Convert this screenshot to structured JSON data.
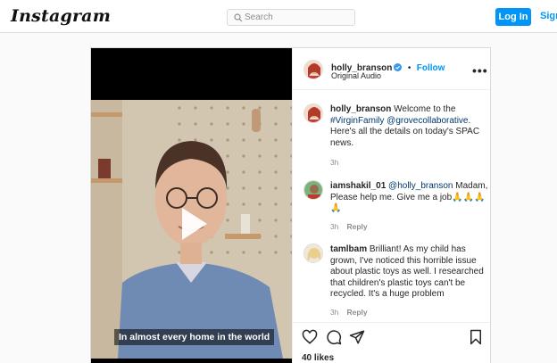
{
  "app": {
    "logo": "Instagram"
  },
  "nav": {
    "search_placeholder": "Search",
    "login_label": "Log In",
    "signup_label": "Sign"
  },
  "video": {
    "caption": "In almost every home in the world"
  },
  "post": {
    "author": "holly_branson",
    "follow_label": "Follow",
    "separator": "•",
    "audio": "Original Audio",
    "more_icon": "more-horizontal-icon"
  },
  "comments": [
    {
      "user": "holly_branson",
      "segments": [
        {
          "text": " Welcome to the "
        },
        {
          "text": "#VirginFamily",
          "link": true
        },
        {
          "text": " "
        },
        {
          "text": "@grovecollaborative",
          "link": true
        },
        {
          "text": ". Here's all the details on today's SPAC news."
        }
      ],
      "time": "3h",
      "reply": ""
    },
    {
      "user": "iamshakil_01",
      "segments": [
        {
          "text": " "
        },
        {
          "text": "@holly_branson",
          "link": true
        },
        {
          "text": " Madam, Please help me. Give me a job🙏🙏🙏🙏"
        }
      ],
      "time": "3h",
      "reply": "Reply"
    },
    {
      "user": "tamlbam",
      "segments": [
        {
          "text": " Brilliant! As my child has grown, I've noticed this horrible issue about plastic toys as well. I researched that children's plastic toys can't be recycled. It's a huge problem"
        }
      ],
      "time": "3h",
      "reply": "Reply"
    }
  ],
  "likes": "40 likes",
  "colors": {
    "accent": "#0095f6",
    "link": "#00376b",
    "border": "#dbdbdb"
  }
}
